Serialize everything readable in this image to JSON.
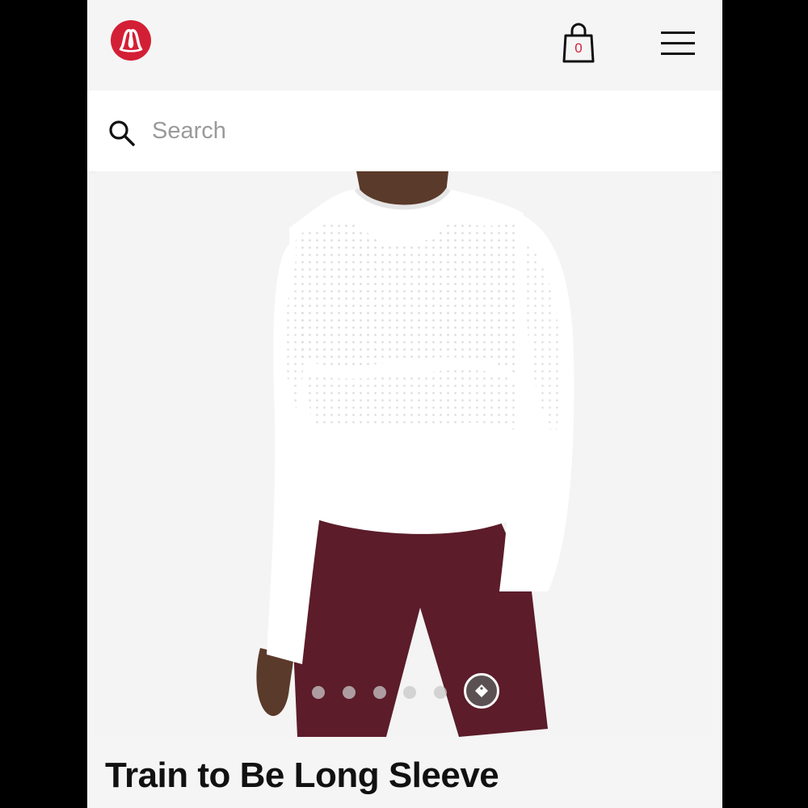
{
  "header": {
    "logo_icon": "lululemon-logo-icon",
    "brand_color": "#d31f35",
    "bag": {
      "icon": "shopping-bag-icon",
      "count": "0"
    },
    "menu_icon": "hamburger-menu-icon"
  },
  "search": {
    "icon": "search-icon",
    "placeholder": "Search",
    "value": ""
  },
  "product": {
    "image": "product-photo",
    "carousel": {
      "total": 6,
      "active_index": 5
    },
    "title": "Train to Be Long Sleeve"
  }
}
